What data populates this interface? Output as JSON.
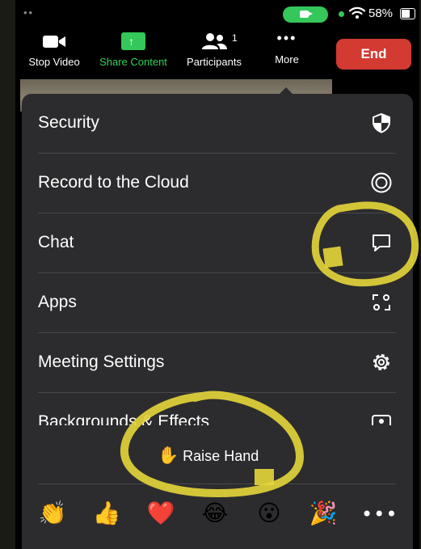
{
  "status": {
    "dots": "••",
    "battery_percent": "58%",
    "battery_level": 0.58,
    "accent_green": "#34c759"
  },
  "toolbar": {
    "stop_video": {
      "label": "Stop Video",
      "icon": "video-camera-icon"
    },
    "share_content": {
      "label": "Share Content",
      "icon": "share-arrow-icon",
      "color": "#32d158"
    },
    "participants": {
      "label": "Participants",
      "icon": "participants-icon",
      "count": "1"
    },
    "more": {
      "label": "More",
      "icon": "more-dots-icon",
      "glyph": "•••"
    },
    "end": {
      "label": "End",
      "color": "#d23a32"
    }
  },
  "menu": {
    "items": [
      {
        "label": "Security",
        "icon": "shield-icon"
      },
      {
        "label": "Record to the Cloud",
        "icon": "record-icon"
      },
      {
        "label": "Chat",
        "icon": "chat-bubble-icon"
      },
      {
        "label": "Apps",
        "icon": "apps-icon"
      },
      {
        "label": "Meeting Settings",
        "icon": "gear-icon"
      },
      {
        "label": "Backgrounds & Effects",
        "icon": "backgrounds-icon"
      }
    ],
    "raise_hand": {
      "emoji": "✋",
      "label": "Raise Hand"
    },
    "reactions": [
      {
        "emoji": "👏",
        "name": "clap"
      },
      {
        "emoji": "👍",
        "name": "thumbs-up"
      },
      {
        "emoji": "❤️",
        "name": "heart"
      },
      {
        "emoji": "😂",
        "name": "tears-of-joy"
      },
      {
        "emoji": "😮",
        "name": "open-mouth"
      },
      {
        "emoji": "🎉",
        "name": "party"
      }
    ],
    "more_reactions": "•••"
  },
  "annotations": {
    "highlight_color": "#e6d63a"
  }
}
